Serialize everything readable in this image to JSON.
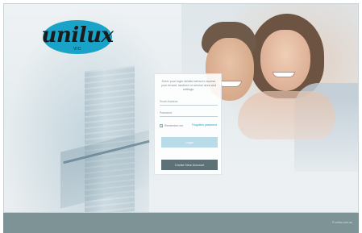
{
  "brand": {
    "logo_text": "unilux",
    "logo_subtext": "VIC",
    "accent_color": "#1aa3c8"
  },
  "login": {
    "intro_text": "Enter your login details below to access your tenant, landlord or service area and settings.",
    "email_placeholder": "Email Address",
    "password_placeholder": "Password",
    "remember_label": "Remember me",
    "remember_checked": true,
    "forgot_link": "Forgotten password",
    "login_button": "Login",
    "create_account_button": "Create New Account"
  },
  "footer": {
    "credit": "© unilux.com.au",
    "bar_color": "#7d9396"
  },
  "icons": {
    "checkbox": "check-icon"
  }
}
